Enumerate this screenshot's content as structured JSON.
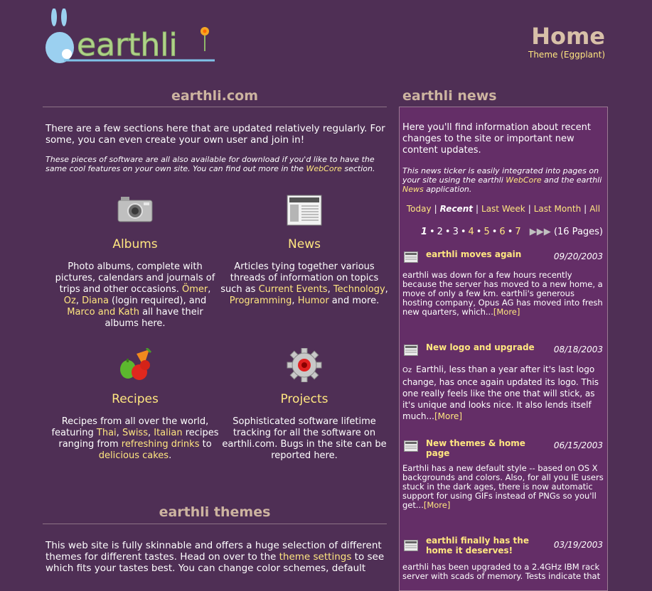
{
  "header": {
    "logo_text": "earthli",
    "page_title": "Home",
    "theme_link": "Theme (Eggplant)"
  },
  "left": {
    "title": "earthli.com",
    "intro": "There are a few sections here that are updated relatively regularly. For some, you can even create your own user and join in!",
    "note_before": "These pieces of software are all also available for download if you'd like to have the same cool features on your own site. You can find out more in the ",
    "note_link": "WebCore",
    "note_after": " section."
  },
  "features": {
    "albums": {
      "title": "Albums",
      "t1": "Photo albums, complete with pictures, calendars and journals of trips and other occasions. ",
      "l1": "Ömer",
      "s1": ", ",
      "l2": "Oz",
      "s2": ", ",
      "l3": "Diana",
      "t2": " (login required), and ",
      "l4": "Marco and Kath",
      "t3": " all have their albums here."
    },
    "news": {
      "title": "News",
      "t1": "Articles tying together various threads of information on topics such as ",
      "l1": "Current Events",
      "s1": ", ",
      "l2": "Technology",
      "s2": ", ",
      "l3": "Programming",
      "s3": ", ",
      "l4": "Humor",
      "t2": " and more."
    },
    "recipes": {
      "title": "Recipes",
      "t1": "Recipes from all over the world, featuring ",
      "l1": "Thai",
      "s1": ", ",
      "l2": "Swiss",
      "s2": ", ",
      "l3": "Italian",
      "t2": " recipes ranging from ",
      "l4": "refreshing drinks",
      "t3": " to ",
      "l5": "delicious cakes",
      "t4": "."
    },
    "projects": {
      "title": "Projects",
      "desc": "Sophisticated software lifetime tracking for all the software on earthli.com. Bugs in the site can be reported here."
    }
  },
  "themes": {
    "title": "earthli themes",
    "t1": "This web site is fully skinnable and offers a huge selection of different themes for different tastes. Head on over to the ",
    "link": "theme settings",
    "t2": " to see which fits your tastes best. You can change color schemes, default"
  },
  "news": {
    "title": "earthli news",
    "intro": "Here you'll find information about recent changes to the site or important new content updates.",
    "note_t1": "This news ticker is easily integrated into pages on your site using the earthli ",
    "note_l1": "WebCore",
    "note_t2": " and the earthli ",
    "note_l2": "News",
    "note_t3": " application.",
    "filters": [
      "Today",
      "Recent",
      "Last Week",
      "Last Month",
      "All"
    ],
    "pager": {
      "pages": [
        "1",
        "2",
        "3",
        "4",
        "5",
        "6",
        "7"
      ],
      "count": "(16 Pages)"
    },
    "more": "[More]",
    "items": [
      {
        "title": "earthli moves again",
        "date": "09/20/2003",
        "body": "earthli was down for a few hours recently because the server has moved to a new home, a move of only a few km. earthli's generous hosting company, Opus AG has moved into fresh new quarters, which..."
      },
      {
        "title": "New logo and upgrade",
        "date": "08/18/2003",
        "avatar": "Oz",
        "body": "Earthli, less than a year after it's last logo change, has once again updated its logo. This one really feels like the one that will stick, as it's unique and looks nice. It also lends itself much..."
      },
      {
        "title": "New themes & home page",
        "date": "06/15/2003",
        "body": "Earthli has a new default style -- based on OS X backgrounds and colors. Also, for all you IE users stuck in the dark ages, there is now automatic support for using GIFs instead of PNGs so you'll get..."
      },
      {
        "title": "earthli finally has the home it deserves!",
        "date": "03/19/2003",
        "body": "earthli has been upgraded to a 2.4GHz IBM rack server with scads of memory. Tests indicate that"
      }
    ]
  },
  "colors": {
    "background": "#4f2f55",
    "news_panel": "#642e67",
    "link": "#ffe680",
    "heading": "#cdb4a0"
  }
}
